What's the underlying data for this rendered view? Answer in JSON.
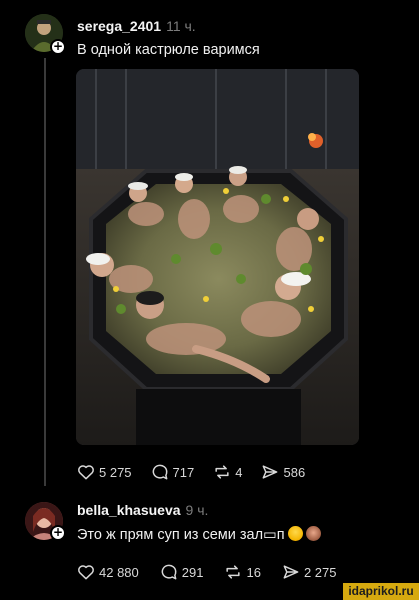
{
  "posts": [
    {
      "username": "serega_2401",
      "time": "11 ч.",
      "text": "В одной кастрюле варимся",
      "image_alt": "hot tub scene",
      "actions": {
        "likes": "5 275",
        "comments": "717",
        "reposts": "4",
        "shares": "586"
      }
    },
    {
      "username": "bella_khasueva",
      "time": "9 ч.",
      "text": "Это ж прям суп из семи зал▭п",
      "actions": {
        "likes": "42 880",
        "comments": "291",
        "reposts": "16",
        "shares": "2 275"
      }
    }
  ],
  "icons": {
    "avatar_badge": "plus-icon",
    "like": "heart-icon",
    "comment": "comment-icon",
    "repost": "repost-icon",
    "share": "send-icon"
  },
  "colors": {
    "background": "#000000",
    "watermark_bg": "#d6a90f",
    "muted": "#7d7d7d"
  },
  "watermark": "idaprikol.ru"
}
